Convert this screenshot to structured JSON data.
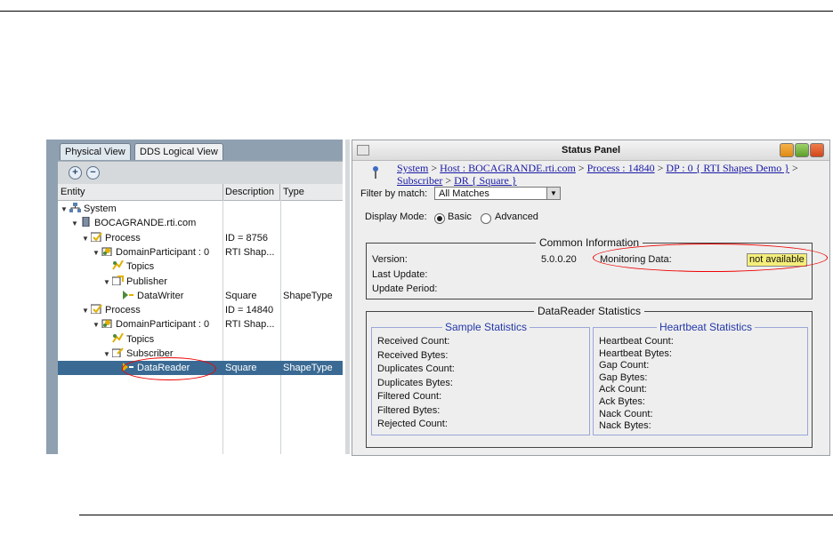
{
  "tabs": [
    {
      "label": "Physical View",
      "active": true
    },
    {
      "label": "DDS Logical View",
      "active": false
    }
  ],
  "tree": {
    "columns": [
      "Entity",
      "Description",
      "Type"
    ],
    "rows": [
      {
        "label": "System",
        "indent": 0,
        "expanded": true,
        "description": "",
        "type": "",
        "icon": "network-icon"
      },
      {
        "label": "BOCAGRANDE.rti.com",
        "indent": 1,
        "expanded": true,
        "description": "",
        "type": "",
        "icon": "host-icon"
      },
      {
        "label": "Process",
        "indent": 2,
        "expanded": true,
        "description": "ID = 8756",
        "type": "",
        "icon": "process-icon"
      },
      {
        "label": "DomainParticipant : 0",
        "indent": 3,
        "expanded": true,
        "description": "RTI Shap...",
        "type": "",
        "icon": "participant-icon"
      },
      {
        "label": "Topics",
        "indent": 4,
        "expanded": false,
        "description": "",
        "type": "",
        "icon": "topics-icon"
      },
      {
        "label": "Publisher",
        "indent": 4,
        "expanded": true,
        "description": "",
        "type": "",
        "icon": "publisher-icon"
      },
      {
        "label": "DataWriter",
        "indent": 5,
        "expanded": false,
        "description": "Square",
        "type": "ShapeType",
        "icon": "datawriter-icon"
      },
      {
        "label": "Process",
        "indent": 2,
        "expanded": true,
        "description": "ID = 14840",
        "type": "",
        "icon": "process-icon"
      },
      {
        "label": "DomainParticipant : 0",
        "indent": 3,
        "expanded": true,
        "description": "RTI Shap...",
        "type": "",
        "icon": "participant-icon"
      },
      {
        "label": "Topics",
        "indent": 4,
        "expanded": false,
        "description": "",
        "type": "",
        "icon": "topics-icon"
      },
      {
        "label": "Subscriber",
        "indent": 4,
        "expanded": true,
        "description": "",
        "type": "",
        "icon": "subscriber-icon"
      },
      {
        "label": "DataReader",
        "indent": 5,
        "expanded": false,
        "description": "Square",
        "type": "ShapeType",
        "icon": "datareader-icon",
        "selected": true
      }
    ]
  },
  "status_panel": {
    "title": "Status Panel",
    "breadcrumb": [
      "System",
      "Host : BOCAGRANDE.rti.com",
      "Process : 14840",
      "DP : 0 { RTI Shapes Demo }",
      "Subscriber",
      "DR { Square }"
    ],
    "breadcrumb_separator": ">",
    "filter_label": "Filter by match:",
    "filter_value": "All Matches",
    "display_mode_label": "Display Mode:",
    "mode_basic": "Basic",
    "mode_advanced": "Advanced",
    "mode_selected": "Basic",
    "common": {
      "title": "Common Information",
      "version_label": "Version:",
      "version_value": "5.0.0.20",
      "last_update_label": "Last Update:",
      "update_period_label": "Update Period:",
      "monitoring_label": "Monitoring Data:",
      "monitoring_value": "not available"
    },
    "dr_stats": {
      "title": "DataReader Statistics",
      "sample_title": "Sample Statistics",
      "sample_items": [
        "Received Count:",
        "Received Bytes:",
        "Duplicates Count:",
        "Duplicates Bytes:",
        "Filtered Count:",
        "Filtered Bytes:",
        "Rejected Count:"
      ],
      "heartbeat_title": "Heartbeat Statistics",
      "heartbeat_items": [
        "Heartbeat Count:",
        "Heartbeat Bytes:",
        "Gap Count:",
        "Gap Bytes:",
        "Ack Count:",
        "Ack Bytes:",
        "Nack Count:",
        "Nack Bytes:"
      ]
    }
  },
  "colors": {
    "selection": "#3a6a93",
    "link": "#1a1aa6",
    "highlight_ellipse": "#e00000",
    "not_available_bg": "#f4ee7a"
  }
}
